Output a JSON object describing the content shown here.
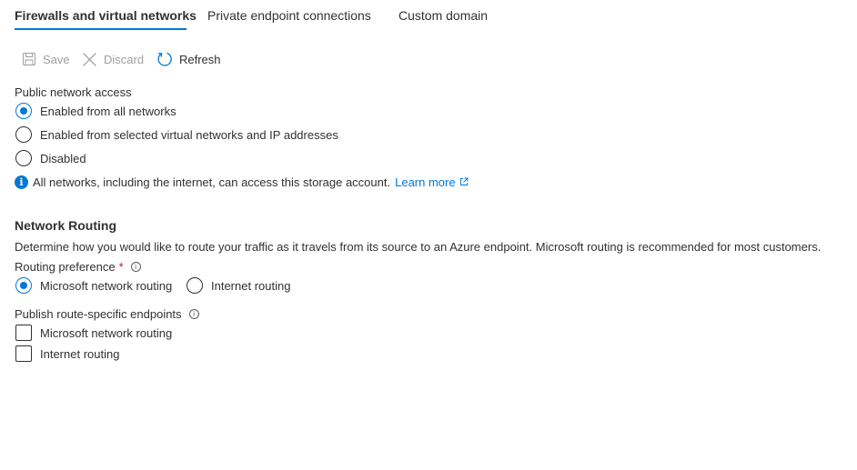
{
  "tabs": [
    {
      "label": "Firewalls and virtual networks",
      "active": true
    },
    {
      "label": "Private endpoint connections",
      "active": false
    },
    {
      "label": "Custom domain",
      "active": false
    }
  ],
  "toolbar": {
    "save_label": "Save",
    "discard_label": "Discard",
    "refresh_label": "Refresh"
  },
  "public_access": {
    "label": "Public network access",
    "options": [
      {
        "label": "Enabled from all networks",
        "selected": true
      },
      {
        "label": "Enabled from selected virtual networks and IP addresses",
        "selected": false
      },
      {
        "label": "Disabled",
        "selected": false
      }
    ],
    "info_text": "All networks, including the internet, can access this storage account.",
    "learn_more": "Learn more"
  },
  "routing": {
    "heading": "Network Routing",
    "description": "Determine how you would like to route your traffic as it travels from its source to an Azure endpoint. Microsoft routing is recommended for most customers.",
    "preference_label": "Routing preference",
    "required_mark": "*",
    "preference_options": [
      {
        "label": "Microsoft network routing",
        "selected": true
      },
      {
        "label": "Internet routing",
        "selected": false
      }
    ],
    "publish_label": "Publish route-specific endpoints",
    "publish_options": [
      {
        "label": "Microsoft network routing",
        "checked": false
      },
      {
        "label": "Internet routing",
        "checked": false
      }
    ]
  },
  "colors": {
    "accent": "#0078d4",
    "text": "#323130",
    "disabled": "#a19f9d",
    "required": "#a4262c"
  },
  "icons": {
    "save": "save-icon",
    "discard": "close-icon",
    "refresh": "refresh-icon",
    "info": "info-icon",
    "external_link": "external-link-icon",
    "tooltip": "info-tooltip-icon"
  }
}
